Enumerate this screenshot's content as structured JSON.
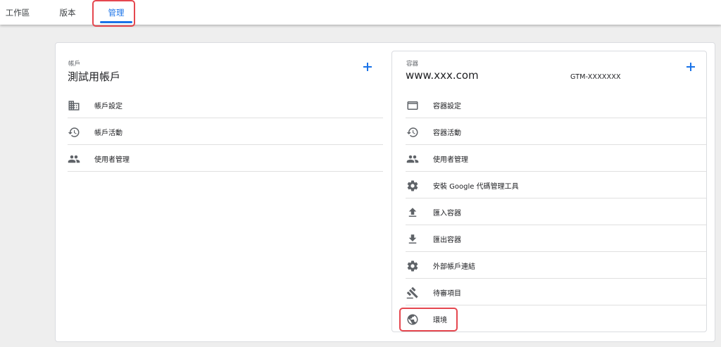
{
  "tabs": [
    {
      "label": "工作區",
      "active": false
    },
    {
      "label": "版本",
      "active": false
    },
    {
      "label": "管理",
      "active": true
    }
  ],
  "colors": {
    "accent": "#1a73e8",
    "highlight": "#e5474f",
    "icon": "#5f6368"
  },
  "account": {
    "section_label": "帳戶",
    "name": "測試用帳戶",
    "add_icon": "plus-icon",
    "items": [
      {
        "label": "帳戶設定",
        "icon": "building-icon"
      },
      {
        "label": "帳戶活動",
        "icon": "history-icon"
      },
      {
        "label": "使用者管理",
        "icon": "people-icon"
      }
    ]
  },
  "container": {
    "section_label": "容器",
    "name": "www.xxx.com",
    "id": "GTM-XXXXXXX",
    "add_icon": "plus-icon",
    "items": [
      {
        "label": "容器設定",
        "icon": "browser-window-icon"
      },
      {
        "label": "容器活動",
        "icon": "history-icon"
      },
      {
        "label": "使用者管理",
        "icon": "people-icon"
      },
      {
        "label": "安裝 Google 代碼管理工具",
        "icon": "gear-icon"
      },
      {
        "label": "匯入容器",
        "icon": "upload-icon"
      },
      {
        "label": "匯出容器",
        "icon": "download-icon"
      },
      {
        "label": "外部帳戶連結",
        "icon": "gear-icon"
      },
      {
        "label": "待審項目",
        "icon": "gavel-icon"
      },
      {
        "label": "環境",
        "icon": "globe-icon"
      }
    ]
  }
}
